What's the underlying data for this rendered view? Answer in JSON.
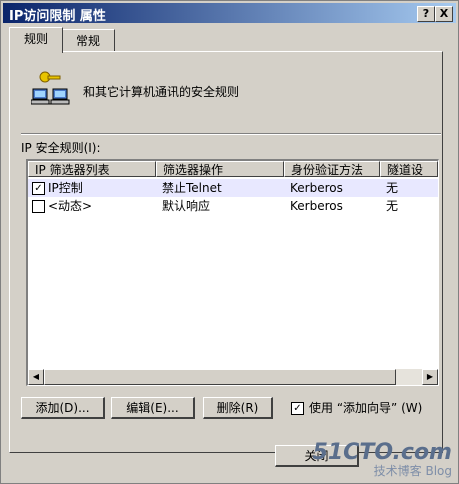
{
  "window": {
    "title": "IP访问限制 属性"
  },
  "titlebar_buttons": {
    "help": "?",
    "close": "X"
  },
  "tabs": [
    {
      "label": "规则"
    },
    {
      "label": "常规"
    }
  ],
  "header": {
    "text": "和其它计算机通讯的安全规则"
  },
  "list": {
    "label": "IP 安全规则(I):",
    "columns": [
      "IP 筛选器列表",
      "筛选器操作",
      "身份验证方法",
      "隧道设"
    ],
    "rows": [
      {
        "checked": true,
        "filter_list": "IP控制",
        "filter_action": "禁止Telnet",
        "auth_method": "Kerberos",
        "tunnel": "无"
      },
      {
        "checked": false,
        "filter_list": "<动态>",
        "filter_action": "默认响应",
        "auth_method": "Kerberos",
        "tunnel": "无"
      }
    ]
  },
  "buttons": {
    "add": "添加(D)...",
    "edit": "编辑(E)...",
    "remove": "删除(R)",
    "close": "关闭"
  },
  "wizard": {
    "label": "使用 “添加向导” (W)",
    "checked": true
  },
  "watermark": {
    "main": "51CTO.com",
    "sub": "技术博客  Blog"
  }
}
